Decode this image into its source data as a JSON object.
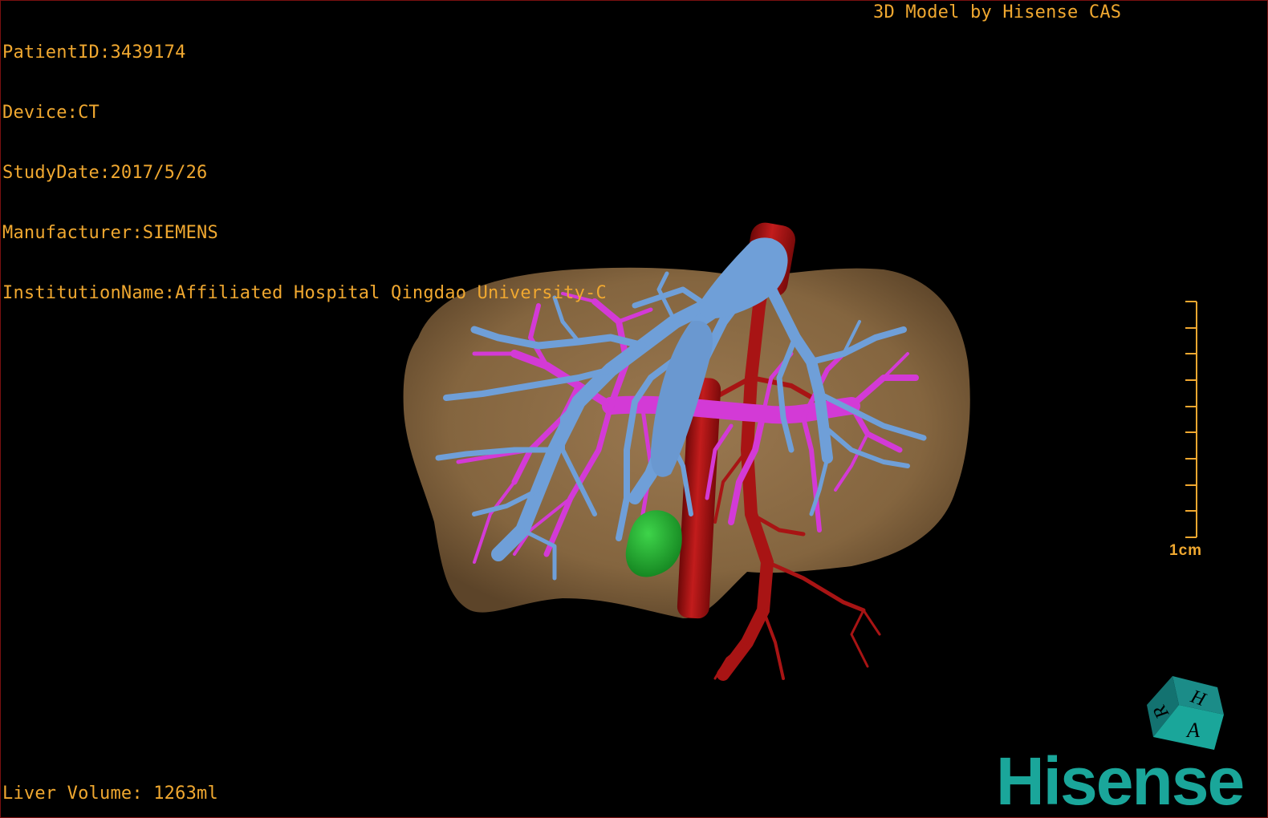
{
  "overlay": {
    "patient_id": "PatientID:3439174",
    "device": "Device:CT",
    "study_date": "StudyDate:2017/5/26",
    "manufacturer": "Manufacturer:SIEMENS",
    "institution": "InstitutionName:Affiliated Hospital Qingdao University-C",
    "credit": "3D Model by Hisense CAS",
    "liver_volume": "Liver Volume: 1263ml"
  },
  "scale": {
    "label": "1cm"
  },
  "cube": {
    "face_top": "H",
    "face_left": "R",
    "face_right": "A"
  },
  "logo": {
    "text": "Hisense"
  },
  "colors": {
    "overlay_text": "#f0a830",
    "liver": "#8c6b48",
    "hepatic_vein": "#6f9fd8",
    "portal_vein": "#d33ad6",
    "artery_ivc": "#a81414",
    "lesion": "#1fae2d",
    "logo": "#1aa69a"
  }
}
